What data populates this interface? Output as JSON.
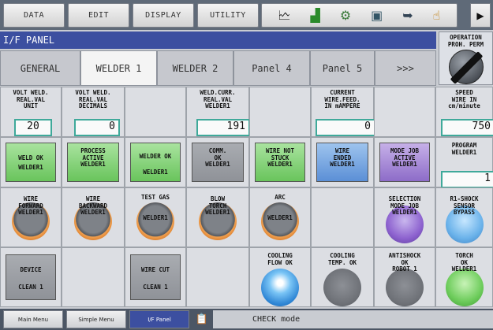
{
  "topmenu": {
    "items": [
      "DATA",
      "EDIT",
      "DISPLAY",
      "UTILITY"
    ],
    "icons": [
      "chart-window-icon",
      "bar-graph-icon",
      "gears-icon",
      "monitor-icon",
      "arrow-window-icon",
      "hand-icon"
    ],
    "play_glyph": "▶"
  },
  "panel": {
    "title": "I/F PANEL",
    "operation_label": "OPERATION\nPROH. PERM"
  },
  "tabs": [
    "GENERAL",
    "WELDER 1",
    "WELDER 2",
    "Panel 4",
    "Panel 5",
    ">>>"
  ],
  "row1": {
    "volt_unit_label": "VOLT WELD.\nREAL.VAL\nUNIT",
    "volt_unit_value": "20",
    "volt_dec_label": "VOLT WELD.\nREAL.VAL\nDECIMALS",
    "volt_dec_value": "0",
    "weld_curr_label": "WELD.CURR.\nREAL.VAL\nWELDER1",
    "weld_curr_value": "191",
    "wire_feed_label": "CURRENT\nWIRE.FEED.\nIN mAMPERE",
    "wire_feed_value": "0",
    "speed_label": "SPEED\nWIRE IN\ncm/minute",
    "speed_value": "750"
  },
  "row2": {
    "weld_ok": "WELD OK",
    "weld_ok_sub": "WELDER1",
    "process_active": "PROCESS\nACTIVE\nWELDER1",
    "welder_ok": "WELDER OK",
    "welder_ok_sub": "WELDER1",
    "comm_ok": "COMM.\nOK\nWELDER1",
    "wire_not_stuck": "WIRE NOT\nSTUCK\nWELDER1",
    "wire_ended": "WIRE\nENDED\nWELDER1",
    "mode_job": "MODE JOB\nACTIVE\nWELDER1",
    "program_label": "PROGRAM\nWELDER1",
    "program_value": "1"
  },
  "row3": {
    "wire_forward": "WIRE\nFORWARD\nWELDER1",
    "wire_backward": "WIRE\nBACKWARD\nWELDER1",
    "test_gas": "TEST GAS",
    "test_gas_sub": "WELDER1",
    "blow_torch": "BLOW\nTORCH\nWELDER1",
    "arc": "ARC",
    "arc_sub": "WELDER1",
    "selection_mode": "SELECTION\nMODE JOB\nWELDER1",
    "r1_shock": "R1-SHOCK\nSENSOR\nBYPASS"
  },
  "row4": {
    "device_clean": "DEVICE",
    "device_clean_sub": "CLEAN 1",
    "wire_cut": "WIRE CUT",
    "wire_cut_sub": "CLEAN 1",
    "cooling_flow": "COOLING\nFLOW OK",
    "cooling_temp": "COOLING\nTEMP. OK",
    "antishock": "ANTISHOCK\nOK\nROBOT 1",
    "torch_ok": "TORCH\nOK\nWELDER1"
  },
  "bottom": {
    "main_menu": "Main Menu",
    "simple_menu": "Simple Menu",
    "if_panel": "I/F Panel",
    "message": "CHECK mode"
  }
}
